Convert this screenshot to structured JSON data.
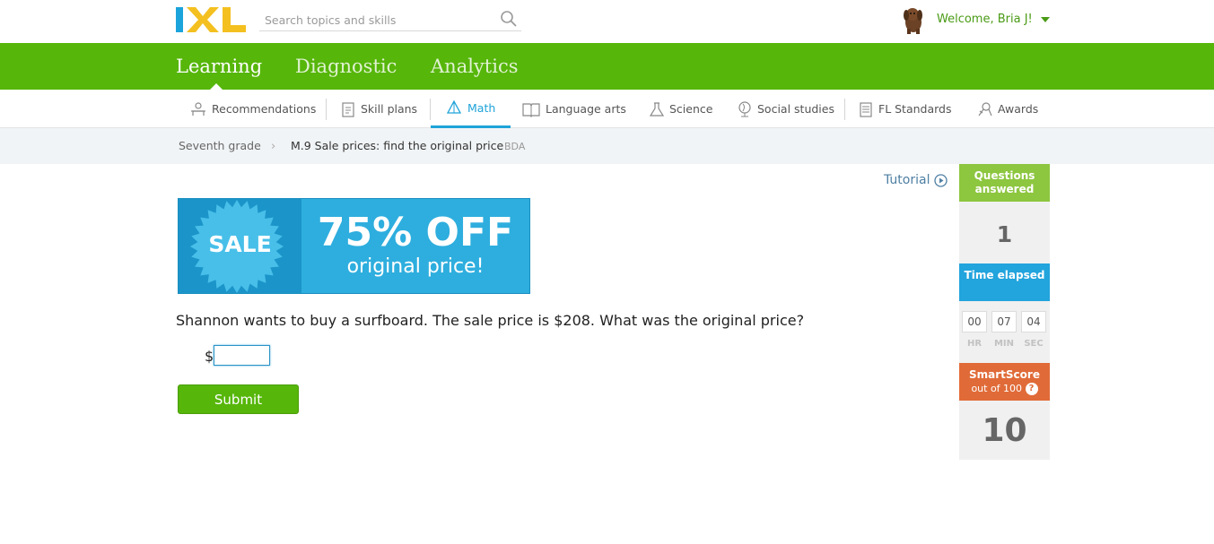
{
  "header": {
    "logo_text": "IXL",
    "search_placeholder": "Search topics and skills",
    "welcome": "Welcome, Bria J!"
  },
  "main_nav": {
    "tabs": [
      {
        "label": "Learning",
        "active": true
      },
      {
        "label": "Diagnostic",
        "active": false
      },
      {
        "label": "Analytics",
        "active": false
      }
    ]
  },
  "subject_nav": {
    "items": [
      {
        "label": "Recommendations",
        "icon": "recommendations-icon"
      },
      {
        "label": "Skill plans",
        "icon": "skill-plans-icon"
      },
      {
        "label": "Math",
        "icon": "math-icon",
        "active": true
      },
      {
        "label": "Language arts",
        "icon": "book-icon"
      },
      {
        "label": "Science",
        "icon": "flask-icon"
      },
      {
        "label": "Social studies",
        "icon": "globe-icon"
      },
      {
        "label": "FL Standards",
        "icon": "standards-icon"
      },
      {
        "label": "Awards",
        "icon": "awards-icon"
      }
    ]
  },
  "breadcrumb": {
    "grade": "Seventh grade",
    "skill": "M.9 Sale prices: find the original price",
    "code": "BDA"
  },
  "tutorial": {
    "label": "Tutorial"
  },
  "banner": {
    "sale": "SALE",
    "discount": "75% OFF",
    "subtitle": "original price!"
  },
  "question": {
    "text": "Shannon wants to buy a surfboard. The sale price is $208. What was the original price?",
    "currency": "$",
    "answer_value": "",
    "submit_label": "Submit"
  },
  "stats": {
    "questions_answered_label": "Questions answered",
    "questions_answered": "1",
    "time_label": "Time elapsed",
    "time": {
      "hr": "00",
      "min": "07",
      "sec": "04"
    },
    "time_units": {
      "hr": "HR",
      "min": "MIN",
      "sec": "SEC"
    },
    "smartscore_label": "SmartScore",
    "smartscore_sub": "out of 100",
    "smartscore_help": "?",
    "smartscore": "10"
  },
  "colors": {
    "brand_green": "#56b60a",
    "math_blue": "#1fa3d9",
    "banner_blue": "#2eaede",
    "stat_green": "#8dc63f",
    "stat_blue": "#22a4dd",
    "stat_orange": "#e06b38"
  }
}
